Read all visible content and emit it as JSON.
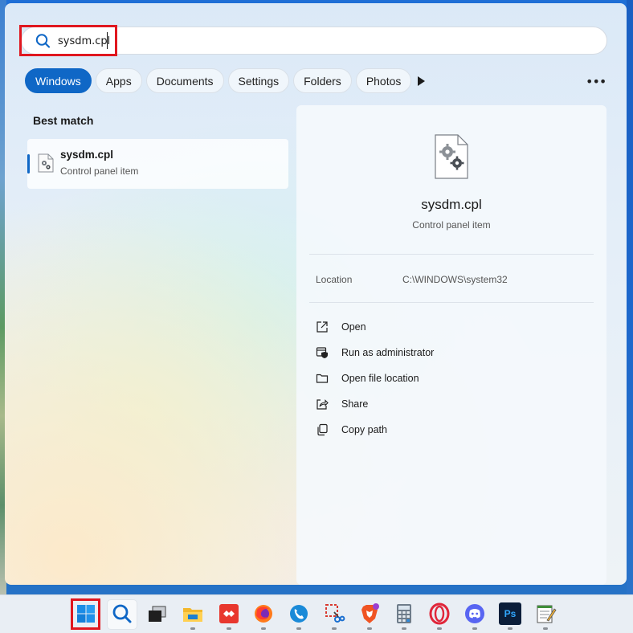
{
  "search": {
    "value": "sysdm.cpl",
    "icon": "search-icon"
  },
  "tabs": [
    {
      "label": "Windows",
      "active": true
    },
    {
      "label": "Apps",
      "active": false
    },
    {
      "label": "Documents",
      "active": false
    },
    {
      "label": "Settings",
      "active": false
    },
    {
      "label": "Folders",
      "active": false
    },
    {
      "label": "Photos",
      "active": false
    }
  ],
  "best_match": {
    "heading": "Best match",
    "title": "sysdm.cpl",
    "subtitle": "Control panel item"
  },
  "preview": {
    "title": "sysdm.cpl",
    "subtitle": "Control panel item",
    "location_label": "Location",
    "location_value": "C:\\WINDOWS\\system32",
    "actions": [
      {
        "label": "Open",
        "icon": "open-external-icon"
      },
      {
        "label": "Run as administrator",
        "icon": "shield-admin-icon"
      },
      {
        "label": "Open file location",
        "icon": "folder-icon"
      },
      {
        "label": "Share",
        "icon": "share-icon"
      },
      {
        "label": "Copy path",
        "icon": "copy-icon"
      }
    ]
  },
  "colors": {
    "accent": "#0f67c6",
    "highlight": "#e0171f"
  },
  "taskbar": {
    "items": [
      "windows-start-icon",
      "search-icon",
      "task-view-icon",
      "file-explorer-icon",
      "anydesk-icon",
      "firefox-icon",
      "skype-icon",
      "snipping-tool-icon",
      "brave-icon",
      "calculator-icon",
      "opera-icon",
      "discord-icon",
      "photoshop-icon",
      "notepad-icon"
    ],
    "photoshop_label": "Ps"
  }
}
